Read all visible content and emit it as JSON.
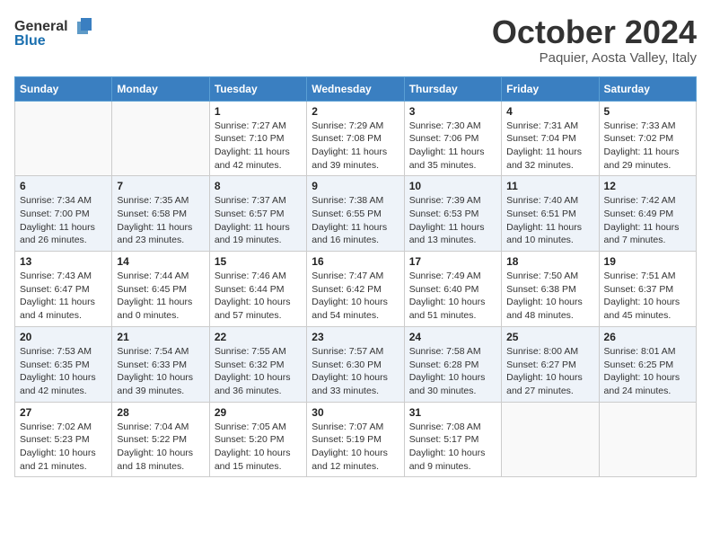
{
  "header": {
    "logo_general": "General",
    "logo_blue": "Blue",
    "month_title": "October 2024",
    "location": "Paquier, Aosta Valley, Italy"
  },
  "columns": [
    "Sunday",
    "Monday",
    "Tuesday",
    "Wednesday",
    "Thursday",
    "Friday",
    "Saturday"
  ],
  "weeks": [
    [
      {
        "day": "",
        "info": ""
      },
      {
        "day": "",
        "info": ""
      },
      {
        "day": "1",
        "info": "Sunrise: 7:27 AM\nSunset: 7:10 PM\nDaylight: 11 hours and 42 minutes."
      },
      {
        "day": "2",
        "info": "Sunrise: 7:29 AM\nSunset: 7:08 PM\nDaylight: 11 hours and 39 minutes."
      },
      {
        "day": "3",
        "info": "Sunrise: 7:30 AM\nSunset: 7:06 PM\nDaylight: 11 hours and 35 minutes."
      },
      {
        "day": "4",
        "info": "Sunrise: 7:31 AM\nSunset: 7:04 PM\nDaylight: 11 hours and 32 minutes."
      },
      {
        "day": "5",
        "info": "Sunrise: 7:33 AM\nSunset: 7:02 PM\nDaylight: 11 hours and 29 minutes."
      }
    ],
    [
      {
        "day": "6",
        "info": "Sunrise: 7:34 AM\nSunset: 7:00 PM\nDaylight: 11 hours and 26 minutes."
      },
      {
        "day": "7",
        "info": "Sunrise: 7:35 AM\nSunset: 6:58 PM\nDaylight: 11 hours and 23 minutes."
      },
      {
        "day": "8",
        "info": "Sunrise: 7:37 AM\nSunset: 6:57 PM\nDaylight: 11 hours and 19 minutes."
      },
      {
        "day": "9",
        "info": "Sunrise: 7:38 AM\nSunset: 6:55 PM\nDaylight: 11 hours and 16 minutes."
      },
      {
        "day": "10",
        "info": "Sunrise: 7:39 AM\nSunset: 6:53 PM\nDaylight: 11 hours and 13 minutes."
      },
      {
        "day": "11",
        "info": "Sunrise: 7:40 AM\nSunset: 6:51 PM\nDaylight: 11 hours and 10 minutes."
      },
      {
        "day": "12",
        "info": "Sunrise: 7:42 AM\nSunset: 6:49 PM\nDaylight: 11 hours and 7 minutes."
      }
    ],
    [
      {
        "day": "13",
        "info": "Sunrise: 7:43 AM\nSunset: 6:47 PM\nDaylight: 11 hours and 4 minutes."
      },
      {
        "day": "14",
        "info": "Sunrise: 7:44 AM\nSunset: 6:45 PM\nDaylight: 11 hours and 0 minutes."
      },
      {
        "day": "15",
        "info": "Sunrise: 7:46 AM\nSunset: 6:44 PM\nDaylight: 10 hours and 57 minutes."
      },
      {
        "day": "16",
        "info": "Sunrise: 7:47 AM\nSunset: 6:42 PM\nDaylight: 10 hours and 54 minutes."
      },
      {
        "day": "17",
        "info": "Sunrise: 7:49 AM\nSunset: 6:40 PM\nDaylight: 10 hours and 51 minutes."
      },
      {
        "day": "18",
        "info": "Sunrise: 7:50 AM\nSunset: 6:38 PM\nDaylight: 10 hours and 48 minutes."
      },
      {
        "day": "19",
        "info": "Sunrise: 7:51 AM\nSunset: 6:37 PM\nDaylight: 10 hours and 45 minutes."
      }
    ],
    [
      {
        "day": "20",
        "info": "Sunrise: 7:53 AM\nSunset: 6:35 PM\nDaylight: 10 hours and 42 minutes."
      },
      {
        "day": "21",
        "info": "Sunrise: 7:54 AM\nSunset: 6:33 PM\nDaylight: 10 hours and 39 minutes."
      },
      {
        "day": "22",
        "info": "Sunrise: 7:55 AM\nSunset: 6:32 PM\nDaylight: 10 hours and 36 minutes."
      },
      {
        "day": "23",
        "info": "Sunrise: 7:57 AM\nSunset: 6:30 PM\nDaylight: 10 hours and 33 minutes."
      },
      {
        "day": "24",
        "info": "Sunrise: 7:58 AM\nSunset: 6:28 PM\nDaylight: 10 hours and 30 minutes."
      },
      {
        "day": "25",
        "info": "Sunrise: 8:00 AM\nSunset: 6:27 PM\nDaylight: 10 hours and 27 minutes."
      },
      {
        "day": "26",
        "info": "Sunrise: 8:01 AM\nSunset: 6:25 PM\nDaylight: 10 hours and 24 minutes."
      }
    ],
    [
      {
        "day": "27",
        "info": "Sunrise: 7:02 AM\nSunset: 5:23 PM\nDaylight: 10 hours and 21 minutes."
      },
      {
        "day": "28",
        "info": "Sunrise: 7:04 AM\nSunset: 5:22 PM\nDaylight: 10 hours and 18 minutes."
      },
      {
        "day": "29",
        "info": "Sunrise: 7:05 AM\nSunset: 5:20 PM\nDaylight: 10 hours and 15 minutes."
      },
      {
        "day": "30",
        "info": "Sunrise: 7:07 AM\nSunset: 5:19 PM\nDaylight: 10 hours and 12 minutes."
      },
      {
        "day": "31",
        "info": "Sunrise: 7:08 AM\nSunset: 5:17 PM\nDaylight: 10 hours and 9 minutes."
      },
      {
        "day": "",
        "info": ""
      },
      {
        "day": "",
        "info": ""
      }
    ]
  ]
}
